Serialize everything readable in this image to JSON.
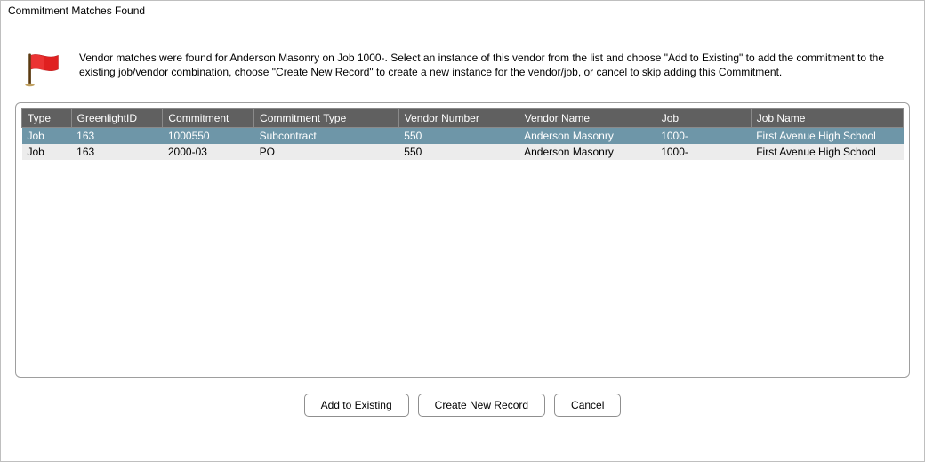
{
  "window": {
    "title": "Commitment Matches Found"
  },
  "info": {
    "text": "Vendor matches were found for Anderson Masonry on Job  1000-.  Select an instance of this vendor from the list and choose \"Add to Existing\" to add the commitment to the existing job/vendor combination, choose \"Create New Record\" to create a new instance for the vendor/job, or cancel to skip adding this Commitment."
  },
  "table": {
    "headers": {
      "type": "Type",
      "greenlightId": "GreenlightID",
      "commitment": "Commitment",
      "commitmentType": "Commitment Type",
      "vendorNumber": "Vendor Number",
      "vendorName": "Vendor Name",
      "job": "Job",
      "jobName": "Job Name"
    },
    "rows": [
      {
        "type": "Job",
        "greenlightId": "163",
        "commitment": "1000550",
        "commitmentType": "Subcontract",
        "vendorNumber": "550",
        "vendorName": "Anderson Masonry",
        "job": "1000-",
        "jobName": "First Avenue High School"
      },
      {
        "type": "Job",
        "greenlightId": "163",
        "commitment": "2000-03",
        "commitmentType": "PO",
        "vendorNumber": "550",
        "vendorName": "Anderson Masonry",
        "job": "1000-",
        "jobName": "First Avenue High School"
      }
    ]
  },
  "buttons": {
    "addToExisting": "Add to Existing",
    "createNewRecord": "Create New Record",
    "cancel": "Cancel"
  }
}
